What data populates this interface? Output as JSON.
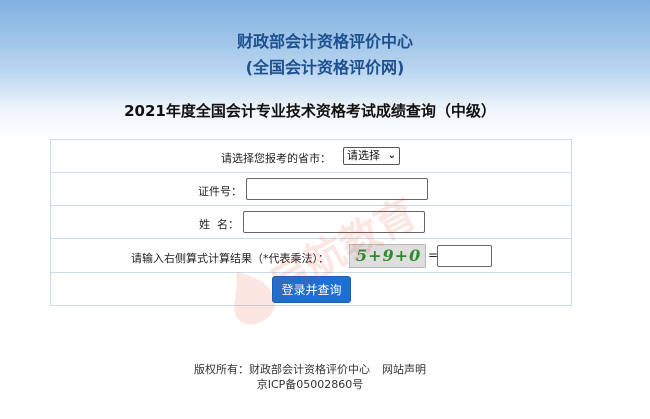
{
  "header": {
    "org_name": "财政部会计资格评价中心",
    "site_name": "(全国会计资格评价网)"
  },
  "exam_title": "2021年度全国会计专业技术资格考试成绩查询（中级）",
  "form": {
    "province_label": "请选择您报考的省市：",
    "province_select_value": "请选择",
    "id_label": "证件号：",
    "id_value": "",
    "name_label": "姓  名：",
    "name_value": "",
    "captcha_label": "请输入右侧算式计算结果（*代表乘法）：",
    "captcha_text": "5+9+0",
    "equals": "=",
    "captcha_answer": "",
    "submit_label": "登录并查询"
  },
  "watermark": {
    "text": "启航教育"
  },
  "footer": {
    "copyright_label": "版权所有：",
    "copyright_owner": "财政部会计资格评价中心",
    "statement_link": "网站声明",
    "icp": "京ICP备05002860号"
  },
  "colors": {
    "header_text": "#1e4f8f",
    "button": "#1d6fd1",
    "table_border": "#c9dcec",
    "captcha_text": "#2d8a2d"
  }
}
